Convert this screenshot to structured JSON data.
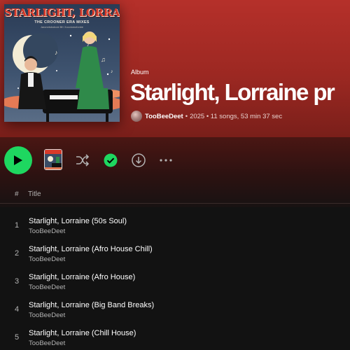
{
  "album": {
    "cover": {
      "title": "STARLIGHT, LORRAINE",
      "subtitle": "THE CROONER ERA MIXES",
      "credit": "Jaronetsboboid Bfr Xocolomofonbe"
    },
    "type_label": "Album",
    "title": "Starlight, Lorraine pr",
    "artist": "TooBeeDeet",
    "separator": "•",
    "details": "2025 • 11 songs, 53 min 37 sec"
  },
  "actions": {
    "play_icon": "play-icon",
    "shuffle_icon": "shuffle-icon",
    "saved_icon": "check-circle-icon",
    "download_icon": "download-icon",
    "more_icon": "more-horizontal-icon"
  },
  "table": {
    "col_number": "#",
    "col_title": "Title"
  },
  "tracks": [
    {
      "number": "1",
      "title": "Starlight, Lorraine (50s Soul)",
      "artist": "TooBeeDeet"
    },
    {
      "number": "2",
      "title": "Starlight, Lorraine (Afro House Chill)",
      "artist": "TooBeeDeet"
    },
    {
      "number": "3",
      "title": "Starlight, Lorraine (Afro House)",
      "artist": "TooBeeDeet"
    },
    {
      "number": "4",
      "title": "Starlight, Lorraine (Big Band Breaks)",
      "artist": "TooBeeDeet"
    },
    {
      "number": "5",
      "title": "Starlight, Lorraine (Chill House)",
      "artist": "TooBeeDeet"
    }
  ],
  "colors": {
    "accent": "#1ed760",
    "header": "#b5302a",
    "background": "#121212",
    "secondary_text": "#b3b3b3"
  }
}
